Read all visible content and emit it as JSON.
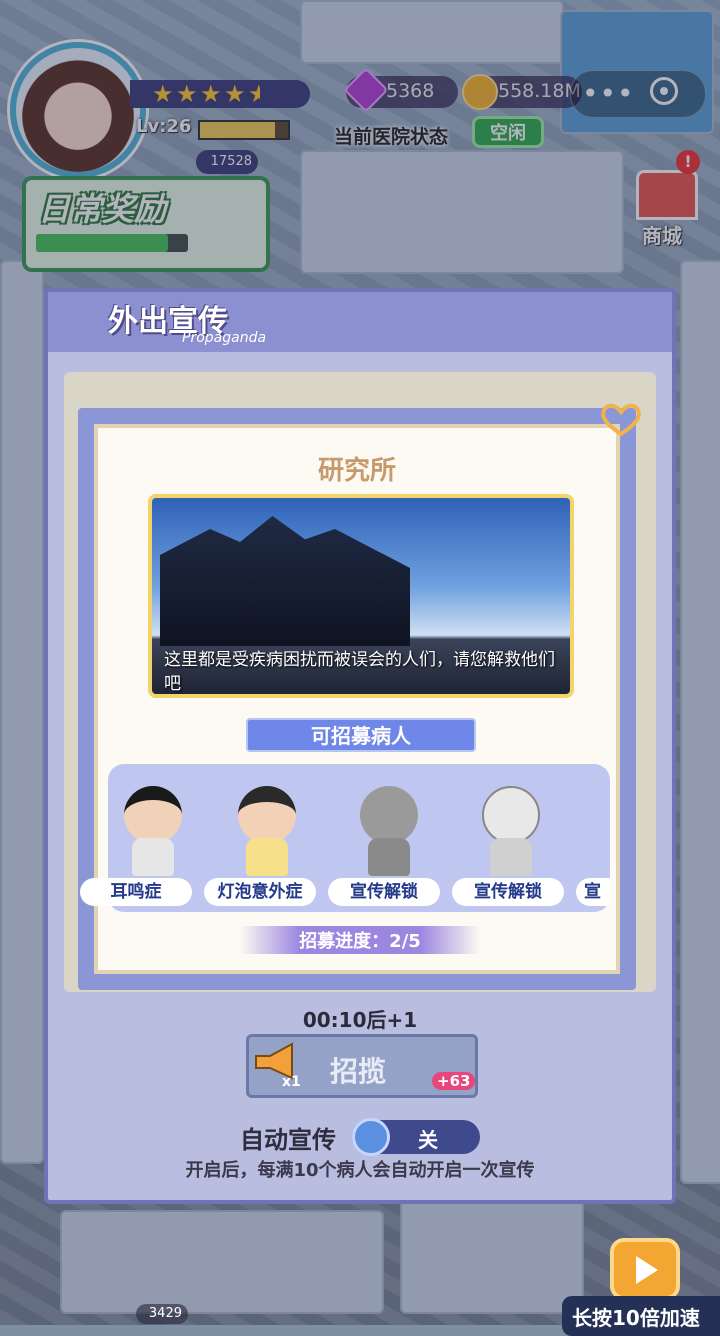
{
  "hud": {
    "level": "Lv:26",
    "level_progress": 0.85,
    "stars": 4.5,
    "gems": "5368",
    "coins": "558.18M",
    "status_label": "当前医院状态",
    "status_value": "空闲",
    "flame_count": "17528",
    "daily_reward": "日常奖励",
    "daily_progress": 0.87,
    "shop_label": "商城",
    "alert": "!"
  },
  "panel": {
    "title": "外出宣传",
    "subtitle": "Propaganda",
    "timer": "00:10后+1",
    "recruit_label": "招揽",
    "recruit_count": "x1",
    "recruit_bonus": "+63",
    "auto_label": "自动宣传",
    "auto_toggle": "关",
    "auto_desc": "开启后，每满10个病人会自动开启一次宣传"
  },
  "modal": {
    "title": "研究所",
    "scene_text": "这里都是受疾病困扰而被误会的人们，请您解救他们吧",
    "section_label": "可招募病人",
    "patients": [
      {
        "label": "耳鸣症"
      },
      {
        "label": "灯泡意外症"
      },
      {
        "label": "宣传解锁"
      },
      {
        "label": "宣传解锁"
      },
      {
        "label": "宣"
      }
    ],
    "progress": "招募进度：2/5"
  },
  "bottom": {
    "speed_label": "长按10倍加速",
    "coins": "3429"
  },
  "colors": {
    "accent": "#6f87e8",
    "status_green": "#2fae4a",
    "panel_border": "#6f73b8"
  }
}
